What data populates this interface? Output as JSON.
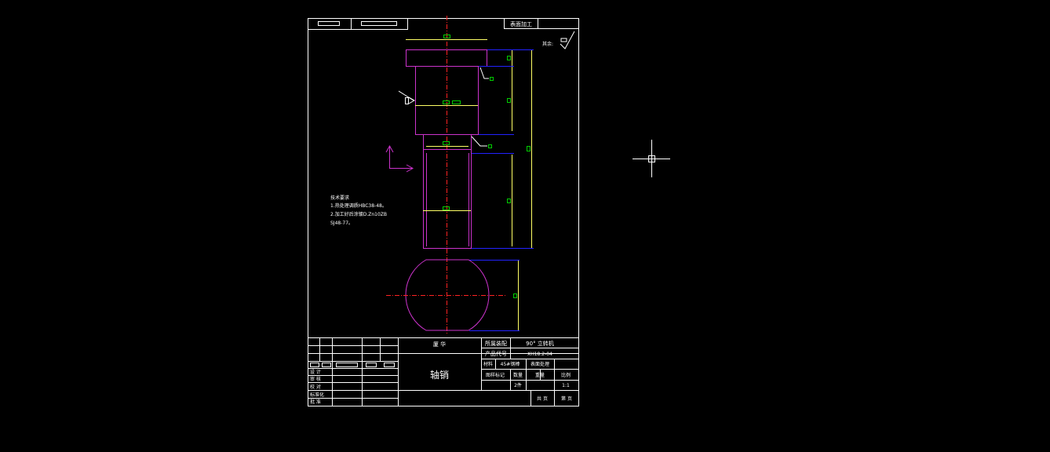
{
  "colors": {
    "background": "#000000",
    "frame": "#ffffff",
    "outline": "#cc33cc",
    "centerline": "#ff2222",
    "dimension": "#2222ff",
    "extension": "#ffff66",
    "annotation": "#00cc00"
  },
  "header": {
    "surface_process": "表面加工",
    "roughness_label": "其余:"
  },
  "tech_requirements": {
    "title": "技术要求",
    "line1": "1.热处理调质HBC38-48。",
    "line2": "2.加工好后涂镀D.Zn10ZB",
    "line3": "SJ48-77。"
  },
  "title_block": {
    "factory": "厦  华",
    "part_name": "轴销",
    "assembly_label": "所属装配",
    "assembly_value": "90° 立转机",
    "product_code_label": "产品代号",
    "product_code_value": "XH18.2-04",
    "material_label": "材料",
    "material_value": "45#钢棒",
    "surface_treatment": "表面处理",
    "change_mark": "图样标记",
    "quantity": "数量",
    "weight": "重量",
    "scale": "比例",
    "quantity_value": "2件",
    "scale_value": "1:1",
    "sheet_total": "共   页",
    "sheet_no": "第   页",
    "design": "设   计",
    "check": "审   核",
    "proofread": "校   对",
    "standardize": "标准化",
    "approve": "批   准"
  },
  "cursor_icon": "crosshair-cursor-icon"
}
